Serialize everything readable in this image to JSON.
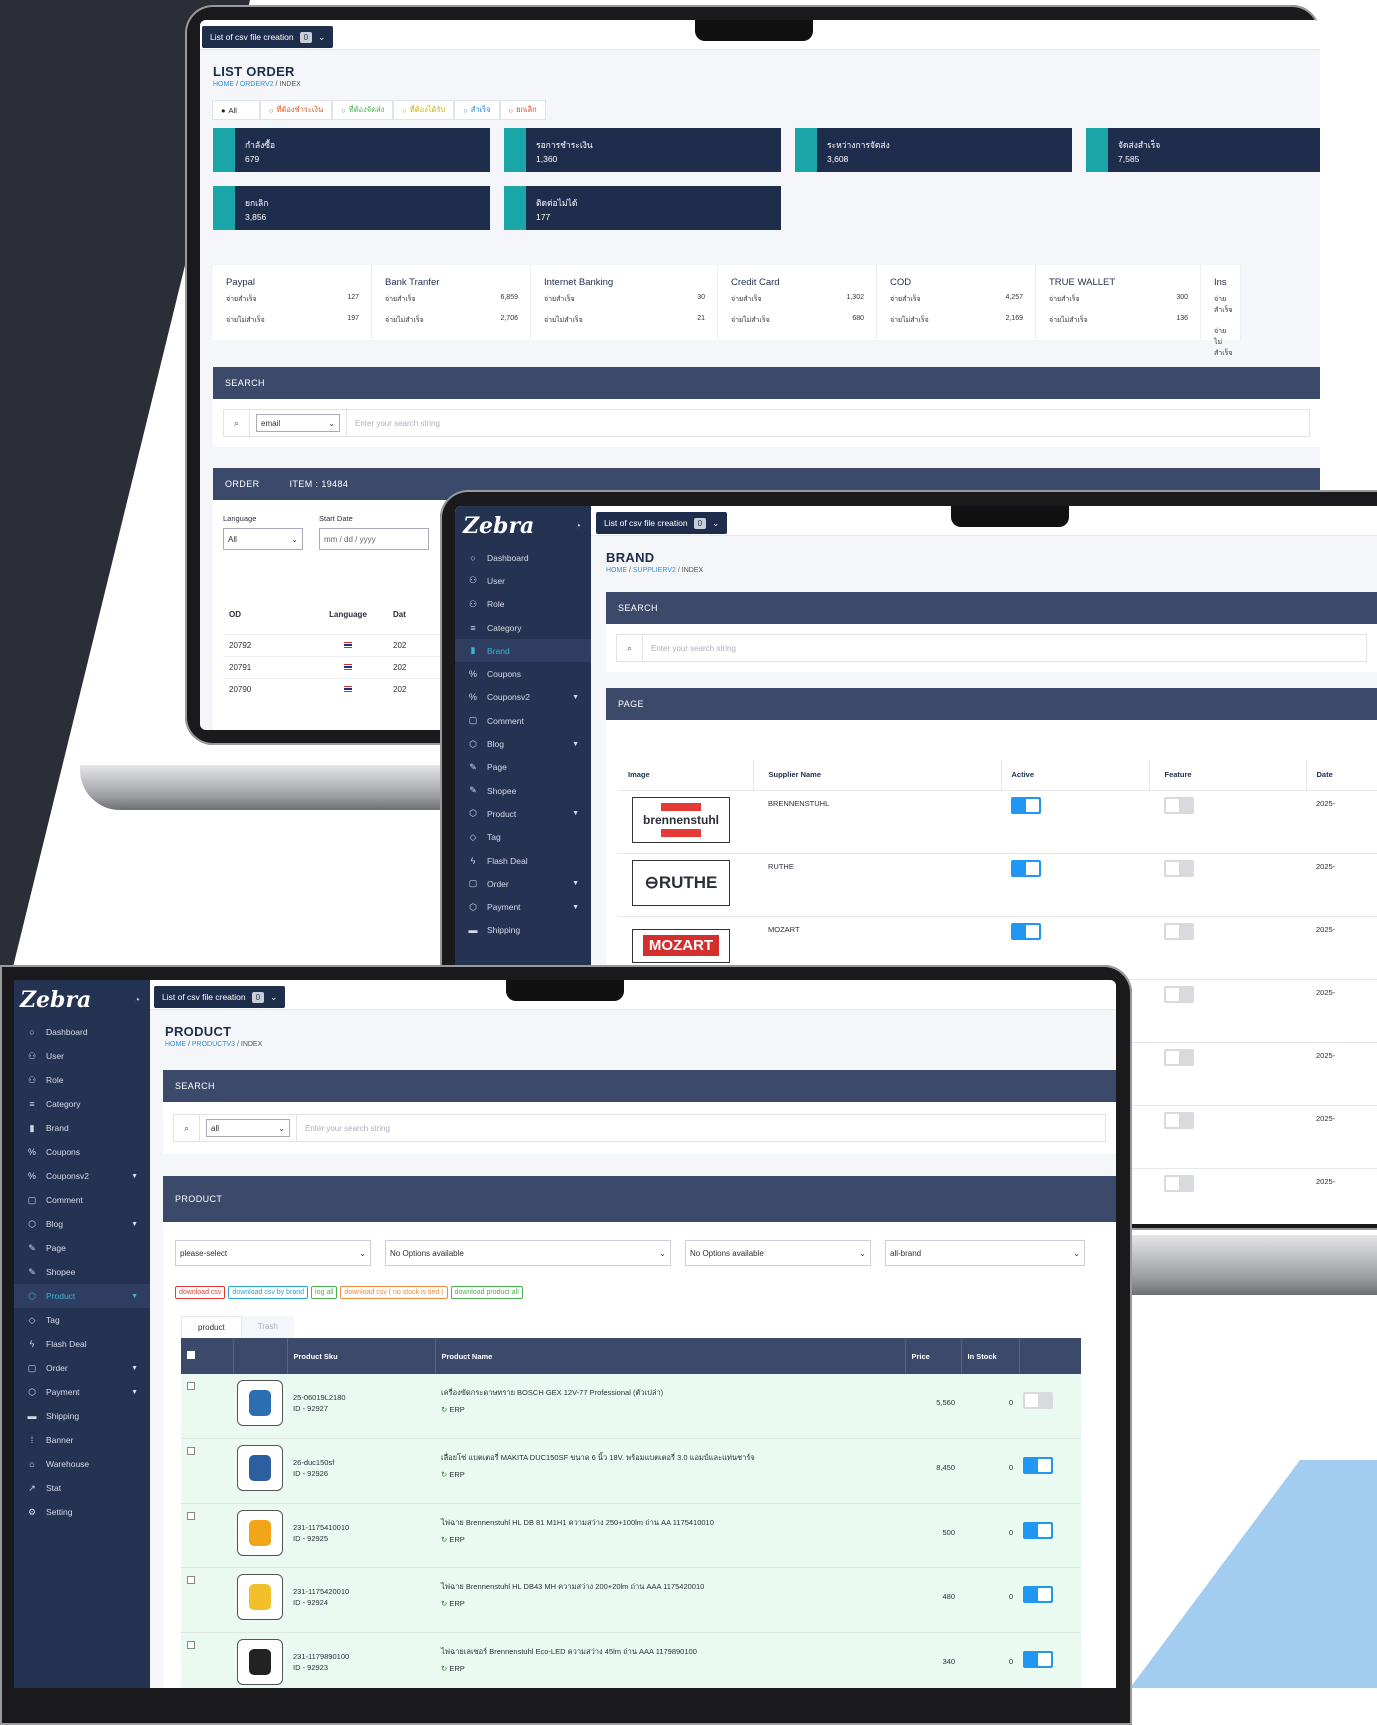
{
  "colors": {
    "dark_bg": "#2b2e36",
    "navy": "#1f2d4d",
    "panel": "#3b4a6b",
    "teal": "#1aa5a8",
    "blue": "#2196f3",
    "light_blue": "#a3cdf0"
  },
  "common": {
    "csv_button": "List of csv file creation",
    "csv_count": "0",
    "home": "HOME",
    "logo": "Zebra"
  },
  "order": {
    "title": "LIST ORDER",
    "crumb_mid": "ORDERV2",
    "crumb_end": "INDEX",
    "tabs": [
      {
        "label": "All",
        "color": "#222",
        "icon": "●"
      },
      {
        "label": "ที่ต้องชำระเงิน",
        "color": "#e8581c",
        "icon": "○"
      },
      {
        "label": "ที่ต้องจัดส่ง",
        "color": "#4caf50",
        "icon": "○"
      },
      {
        "label": "ที่ต้องได้รับ",
        "color": "#c7b20a",
        "icon": "○"
      },
      {
        "label": "สำเร็จ",
        "color": "#1e88e5",
        "icon": "○"
      },
      {
        "label": "ยกเลิก",
        "color": "#e53935",
        "icon": "○"
      }
    ],
    "stats": [
      {
        "label": "กำลังซื้อ",
        "value": "679"
      },
      {
        "label": "รอการชำระเงิน",
        "value": "1,360"
      },
      {
        "label": "ระหว่างการจัดส่ง",
        "value": "3,608"
      },
      {
        "label": "จัดส่งสำเร็จ",
        "value": "7,585"
      },
      {
        "label": "ยกเลิก",
        "value": "3,856"
      },
      {
        "label": "ติดต่อไม่ได้",
        "value": "177"
      }
    ],
    "pay_success_label": "จ่ายสำเร็จ",
    "pay_fail_label": "จ่ายไม่สำเร็จ",
    "payments": [
      {
        "name": "Paypal",
        "ok": "127",
        "fail": "197"
      },
      {
        "name": "Bank Tranfer",
        "ok": "6,859",
        "fail": "2,706"
      },
      {
        "name": "Internet Banking",
        "ok": "30",
        "fail": "21"
      },
      {
        "name": "Credit Card",
        "ok": "1,302",
        "fail": "680"
      },
      {
        "name": "COD",
        "ok": "4,257",
        "fail": "2,169"
      },
      {
        "name": "TRUE WALLET",
        "ok": "300",
        "fail": "136"
      },
      {
        "name": "Ins",
        "ok": "",
        "fail": ""
      }
    ],
    "search_head": "SEARCH",
    "search_select": "email",
    "search_placeholder": "Enter your search string",
    "order_head": "ORDER",
    "item_count": "ITEM : 19484",
    "language_label": "Language",
    "language_value": "All",
    "start_date_label": "Start Date",
    "date_placeholder": "mm / dd / yyyy",
    "col_od": "OD",
    "col_language": "Language",
    "col_date": "Dat",
    "rows": [
      {
        "od": "20792",
        "date": "202"
      },
      {
        "od": "20791",
        "date": "202"
      },
      {
        "od": "20790",
        "date": "202"
      }
    ]
  },
  "brand": {
    "title": "BRAND",
    "crumb_mid": "SUPPLIERV2",
    "crumb_end": "INDEX",
    "search_head": "SEARCH",
    "search_placeholder": "Enter your search string",
    "page_head": "PAGE",
    "col_image": "Image",
    "col_supplier": "Supplier Name",
    "col_active": "Active",
    "col_feature": "Feature",
    "col_date": "Date",
    "rows": [
      {
        "name": "BRENNENSTUHL",
        "logo": "brennenstuhl",
        "date": "2025-",
        "active": true
      },
      {
        "name": "RUTHE",
        "logo": "RUTHE",
        "date": "2025-",
        "active": true
      },
      {
        "name": "MOZART",
        "logo": "MOZART",
        "date": "2025-",
        "active": true
      },
      {
        "name": "",
        "logo": "",
        "date": "2025-",
        "active": false
      },
      {
        "name": "",
        "logo": "",
        "date": "2025-",
        "active": false
      },
      {
        "name": "",
        "logo": "",
        "date": "2025-",
        "active": false
      },
      {
        "name": "",
        "logo": "",
        "date": "2025-",
        "active": false
      }
    ],
    "menu": [
      {
        "label": "Dashboard",
        "icon": "○"
      },
      {
        "label": "User",
        "icon": "⚇"
      },
      {
        "label": "Role",
        "icon": "⚇"
      },
      {
        "label": "Category",
        "icon": "≡"
      },
      {
        "label": "Brand",
        "icon": "▮",
        "active": true
      },
      {
        "label": "Coupons",
        "icon": "%"
      },
      {
        "label": "Couponsv2",
        "icon": "%",
        "caret": true
      },
      {
        "label": "Comment",
        "icon": "▢"
      },
      {
        "label": "Blog",
        "icon": "⬡",
        "caret": true
      },
      {
        "label": "Page",
        "icon": "✎"
      },
      {
        "label": "Shopee",
        "icon": "✎"
      },
      {
        "label": "Product",
        "icon": "⬡",
        "caret": true
      },
      {
        "label": "Tag",
        "icon": "◇"
      },
      {
        "label": "Flash Deal",
        "icon": "ϟ"
      },
      {
        "label": "Order",
        "icon": "▢",
        "caret": true
      },
      {
        "label": "Payment",
        "icon": "⬡",
        "caret": true
      },
      {
        "label": "Shipping",
        "icon": "▬"
      }
    ]
  },
  "product": {
    "title": "PRODUCT",
    "crumb_mid": "PRODUCTV3",
    "crumb_end": "INDEX",
    "search_head": "SEARCH",
    "search_select": "all",
    "search_placeholder": "Enter your search string",
    "product_head": "PRODUCT",
    "filters": [
      "please-select",
      "No Options available",
      "No Options available",
      "all-brand"
    ],
    "buttons": [
      {
        "label": "download csv",
        "color": "#e53935"
      },
      {
        "label": "download csv by brand",
        "color": "#29a3d6"
      },
      {
        "label": "log all",
        "color": "#4caf50"
      },
      {
        "label": "download csv ( no stock is tied )",
        "color": "#f08a3c"
      },
      {
        "label": "download product all",
        "color": "#4caf50"
      }
    ],
    "tab_product": "product",
    "tab_trash": "Trash",
    "col_sku": "Product Sku",
    "col_name": "Product Name",
    "col_price": "Price",
    "col_stock": "In Stock",
    "erp": "ERP",
    "rows": [
      {
        "sku": "25-06019L2180",
        "id": "ID - 92927",
        "name": "เครื่องขัดกระดาษทราย BOSCH GEX 12V-77 Professional (ตัวเปล่า)",
        "price": "5,560",
        "stock": "0",
        "active": false
      },
      {
        "sku": "26-duc150sf",
        "id": "ID - 92926",
        "name": "เลื่อยโซ่ แบตเตอรี่ MAKITA DUC150SF ขนาด 6 นิ้ว 18V. พร้อมแบตเตอรี่ 3.0 แอมป์และแท่นชาร์จ",
        "price": "8,450",
        "stock": "0",
        "active": true
      },
      {
        "sku": "231-1175410010",
        "id": "ID - 92925",
        "name": "ไฟฉาย Brennenstuhl HL DB 81 M1H1 ความสว่าง 250+100lm ถ่าน AA 1175410010",
        "price": "500",
        "stock": "0",
        "active": true
      },
      {
        "sku": "231-1175420010",
        "id": "ID - 92924",
        "name": "ไฟฉาย Brennenstuhl HL DB43 MH ความสว่าง 200+20lm ถ่าน AAA 1175420010",
        "price": "480",
        "stock": "0",
        "active": true
      },
      {
        "sku": "231-1179890100",
        "id": "ID - 92923",
        "name": "ไฟฉายเลเซอร์ Brennenstuhl Eco-LED ความสว่าง 45lm ถ่าน AAA 1179890100",
        "price": "340",
        "stock": "0",
        "active": true
      }
    ],
    "menu": [
      {
        "label": "Dashboard",
        "icon": "○"
      },
      {
        "label": "User",
        "icon": "⚇"
      },
      {
        "label": "Role",
        "icon": "⚇"
      },
      {
        "label": "Category",
        "icon": "≡"
      },
      {
        "label": "Brand",
        "icon": "▮"
      },
      {
        "label": "Coupons",
        "icon": "%"
      },
      {
        "label": "Couponsv2",
        "icon": "%",
        "caret": true
      },
      {
        "label": "Comment",
        "icon": "▢"
      },
      {
        "label": "Blog",
        "icon": "⬡",
        "caret": true
      },
      {
        "label": "Page",
        "icon": "✎"
      },
      {
        "label": "Shopee",
        "icon": "✎"
      },
      {
        "label": "Product",
        "icon": "⬡",
        "caret": true,
        "active": true
      },
      {
        "label": "Tag",
        "icon": "◇"
      },
      {
        "label": "Flash Deal",
        "icon": "ϟ"
      },
      {
        "label": "Order",
        "icon": "▢",
        "caret": true
      },
      {
        "label": "Payment",
        "icon": "⬡",
        "caret": true
      },
      {
        "label": "Shipping",
        "icon": "▬"
      },
      {
        "label": "Banner",
        "icon": "⁞"
      },
      {
        "label": "Warehouse",
        "icon": "⌂"
      },
      {
        "label": "Stat",
        "icon": "↗"
      },
      {
        "label": "Setting",
        "icon": "⚙"
      }
    ]
  }
}
